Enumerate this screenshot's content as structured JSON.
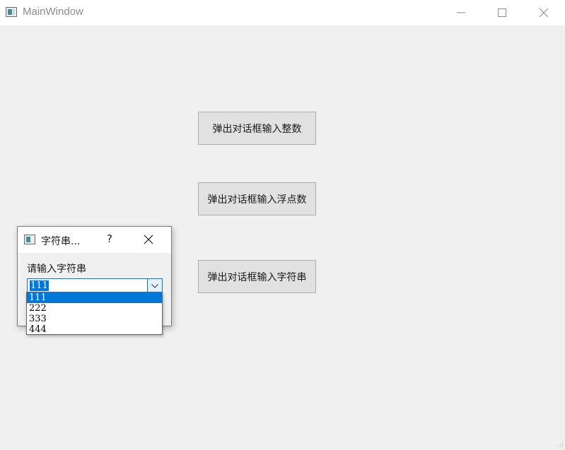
{
  "window": {
    "title": "MainWindow"
  },
  "main": {
    "buttons": [
      {
        "label": "弹出对话框输入整数"
      },
      {
        "label": "弹出对话框输入浮点数"
      },
      {
        "label": "弹出对话框输入字符串"
      }
    ]
  },
  "dialog": {
    "title": "字符串...",
    "help": "?",
    "prompt": "请输入字符串",
    "combo_value": "111",
    "options": [
      "111",
      "222",
      "333",
      "444"
    ],
    "selected_option": "111"
  },
  "colors": {
    "accent": "#0078d7",
    "background": "#f0f0f0",
    "button_face": "#e1e1e1"
  },
  "icons": {
    "app": "app-window-icon",
    "minimize": "minimize-icon",
    "maximize": "maximize-icon",
    "close": "close-icon",
    "dropdown": "chevron-down-icon"
  }
}
